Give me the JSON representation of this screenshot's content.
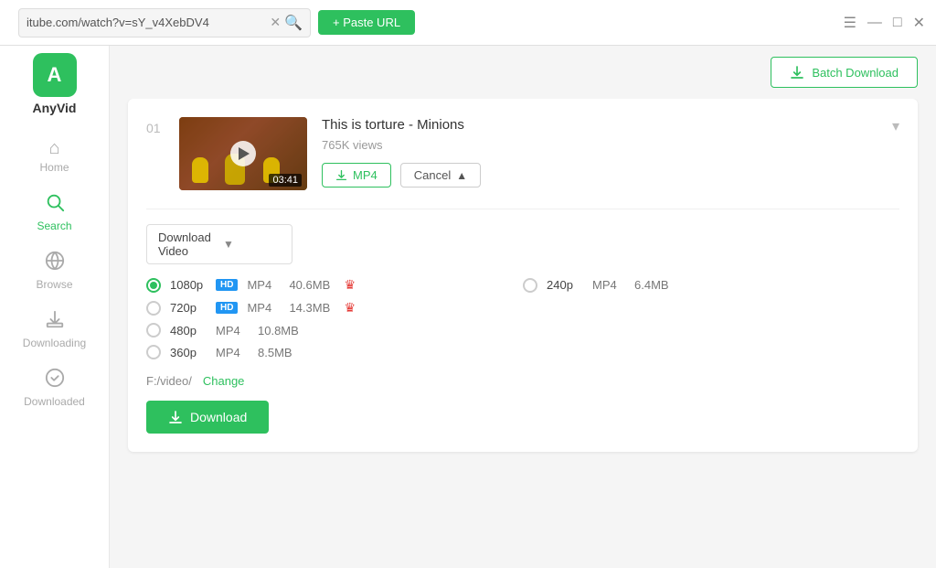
{
  "titlebar": {
    "url": "itube.com/watch?v=sY_v4XebDV4",
    "paste_label": "+ Paste URL"
  },
  "window_controls": {
    "menu": "☰",
    "minimize": "—",
    "maximize": "□",
    "close": "✕"
  },
  "sidebar": {
    "logo_letter": "A",
    "app_name": "AnyVid",
    "nav_items": [
      {
        "id": "home",
        "label": "Home",
        "icon": "⌂"
      },
      {
        "id": "search",
        "label": "Search",
        "icon": "🔍"
      },
      {
        "id": "browse",
        "label": "Browse",
        "icon": "🌐"
      },
      {
        "id": "downloading",
        "label": "Downloading",
        "icon": "⬇"
      },
      {
        "id": "downloaded",
        "label": "Downloaded",
        "icon": "✓"
      }
    ]
  },
  "top_bar": {
    "batch_download_label": "Batch Download"
  },
  "video": {
    "number": "01",
    "title": "This is torture - Minions",
    "views": "765K views",
    "duration": "03:41",
    "mp4_btn_label": "MP4",
    "cancel_btn_label": "Cancel"
  },
  "download_options": {
    "dropdown_label": "Download Video",
    "qualities": [
      {
        "id": "1080p",
        "label": "1080p",
        "hd": true,
        "format": "MP4",
        "size": "40.6MB",
        "crown": true,
        "selected": true
      },
      {
        "id": "720p",
        "label": "720p",
        "hd": true,
        "format": "MP4",
        "size": "14.3MB",
        "crown": true,
        "selected": false
      },
      {
        "id": "480p",
        "label": "480p",
        "hd": false,
        "format": "MP4",
        "size": "10.8MB",
        "crown": false,
        "selected": false
      },
      {
        "id": "360p",
        "label": "360p",
        "hd": false,
        "format": "MP4",
        "size": "8.5MB",
        "crown": false,
        "selected": false
      },
      {
        "id": "240p",
        "label": "240p",
        "hd": false,
        "format": "MP4",
        "size": "6.4MB",
        "crown": false,
        "selected": false
      }
    ],
    "save_path": "F:/video/",
    "change_label": "Change",
    "download_btn_label": "Download"
  }
}
